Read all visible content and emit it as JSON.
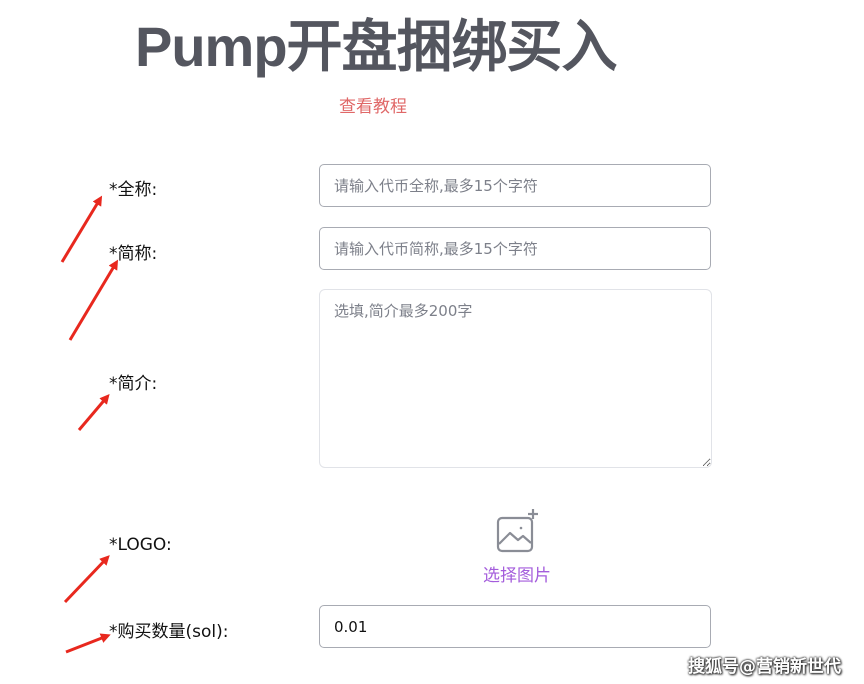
{
  "page": {
    "title": "Pump开盘捆绑买入",
    "tutorial_link": "查看教程"
  },
  "form": {
    "full_name": {
      "label": "*全称:",
      "placeholder": "请输入代币全称,最多15个字符",
      "value": ""
    },
    "short_name": {
      "label": "*简称:",
      "placeholder": "请输入代币简称,最多15个字符",
      "value": ""
    },
    "description": {
      "label": "*简介:",
      "placeholder": "选填,简介最多200字",
      "value": ""
    },
    "logo": {
      "label": "*LOGO:",
      "button_label": "选择图片",
      "icon": "image-add-icon"
    },
    "buy_amount": {
      "label": "*购买数量(sol):",
      "value": "0.01"
    }
  },
  "watermark": "搜狐号@营销新世代",
  "colors": {
    "title": "#54565f",
    "tutorial_link": "#e06868",
    "upload_label": "#a45ddc",
    "annotation_arrow": "#e8281e"
  }
}
